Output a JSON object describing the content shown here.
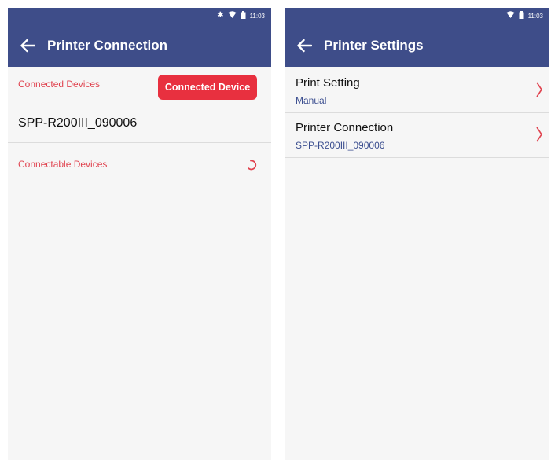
{
  "left_screen": {
    "status": {
      "time": "11:03",
      "icons": [
        "bluetooth-icon",
        "wifi-icon",
        "battery-icon"
      ]
    },
    "toolbar": {
      "title": "Printer Connection"
    },
    "connected_devices_label": "Connected Devices",
    "connected_device_button": "Connected Device",
    "connected_device_name": "SPP-R200III_090006",
    "connectable_devices_label": "Connectable Devices"
  },
  "right_screen": {
    "status": {
      "time": "11:03",
      "icons": [
        "wifi-icon",
        "battery-icon"
      ]
    },
    "toolbar": {
      "title": "Printer Settings"
    },
    "rows": [
      {
        "title": "Print Setting",
        "value": "Manual"
      },
      {
        "title": "Printer Connection",
        "value": "SPP-R200III_090006"
      }
    ]
  },
  "colors": {
    "toolbar": "#3e4d89",
    "accent_red": "#e8303f",
    "value_blue": "#3c4f90"
  }
}
